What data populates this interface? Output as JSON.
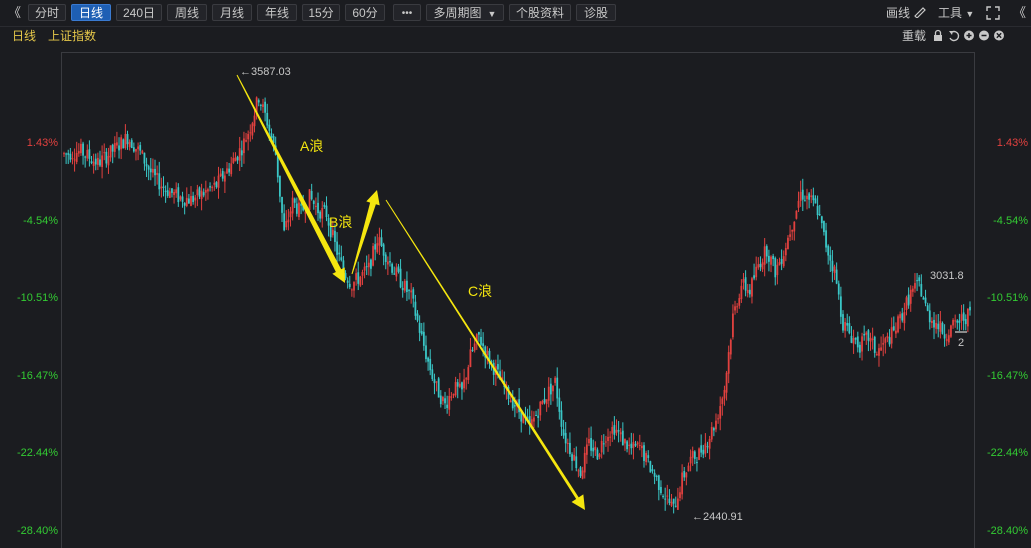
{
  "toolbar": {
    "collapse_left": "《",
    "tabs": [
      {
        "label": "分时",
        "active": false
      },
      {
        "label": "日线",
        "active": true
      },
      {
        "label": "240日",
        "active": false
      },
      {
        "label": "周线",
        "active": false
      },
      {
        "label": "月线",
        "active": false
      },
      {
        "label": "年线",
        "active": false
      },
      {
        "label": "15分",
        "active": false
      },
      {
        "label": "60分",
        "active": false
      }
    ],
    "more": "•••",
    "multi_period": "多周期图",
    "stock_info": "个股资料",
    "diagnose": "诊股",
    "draw": "画线",
    "tools": "工具",
    "expand_icon": "expand-icon",
    "collapse_right": "《"
  },
  "subbar": {
    "period": "日线",
    "index_name": "上证指数",
    "reload": "重载"
  },
  "y_axis": {
    "ticks": [
      "1.43%",
      "-4.54%",
      "-10.51%",
      "-16.47%",
      "-22.44%",
      "-28.40%"
    ],
    "tick_values": [
      1.43,
      -4.54,
      -10.51,
      -16.47,
      -22.44,
      -28.4
    ]
  },
  "annotations": {
    "high_label": "←3587.03",
    "low_label": "←2440.91",
    "last_label": "3031.8",
    "count_badge": "2",
    "wave_a": "A浪",
    "wave_b": "B浪",
    "wave_c": "C浪"
  },
  "colors": {
    "up": "#e2413f",
    "down": "#3ac7c7",
    "arrow": "#f5e60f",
    "active_tab": "#1e5fb4",
    "label_gold": "#e6c84a"
  },
  "chart_data": {
    "type": "candlestick",
    "title": "",
    "ylabel": "",
    "ylim": [
      -30.0,
      5.5
    ],
    "high": 3587.03,
    "low": 2440.91,
    "last": 3031.8,
    "trend_path_pct": [
      [
        0,
        0.5
      ],
      [
        8,
        0.7
      ],
      [
        16,
        -0.2
      ],
      [
        24,
        0.9
      ],
      [
        30,
        1.8
      ],
      [
        36,
        0.6
      ],
      [
        42,
        -1.2
      ],
      [
        48,
        -2.2
      ],
      [
        54,
        -2.8
      ],
      [
        60,
        -3.0
      ],
      [
        66,
        -2.5
      ],
      [
        72,
        -1.9
      ],
      [
        78,
        -0.5
      ],
      [
        84,
        1.0
      ],
      [
        88,
        2.6
      ],
      [
        92,
        4.9
      ],
      [
        96,
        3.0
      ],
      [
        100,
        0.5
      ],
      [
        104,
        -5.6
      ],
      [
        108,
        -3.2
      ],
      [
        112,
        -4.0
      ],
      [
        116,
        -2.8
      ],
      [
        120,
        -3.8
      ],
      [
        124,
        -4.1
      ],
      [
        128,
        -6.5
      ],
      [
        132,
        -8.5
      ],
      [
        136,
        -9.5
      ],
      [
        140,
        -8.9
      ],
      [
        144,
        -8.3
      ],
      [
        148,
        -6.0
      ],
      [
        152,
        -7.2
      ],
      [
        156,
        -8.5
      ],
      [
        160,
        -9.5
      ],
      [
        164,
        -10.5
      ],
      [
        168,
        -13.0
      ],
      [
        172,
        -15.5
      ],
      [
        176,
        -17.5
      ],
      [
        180,
        -18.8
      ],
      [
        184,
        -17.5
      ],
      [
        188,
        -17.8
      ],
      [
        192,
        -15.0
      ],
      [
        196,
        -13.5
      ],
      [
        200,
        -15.0
      ],
      [
        204,
        -16.2
      ],
      [
        208,
        -17.5
      ],
      [
        212,
        -18.5
      ],
      [
        216,
        -19.5
      ],
      [
        220,
        -20.5
      ],
      [
        224,
        -19.2
      ],
      [
        228,
        -18.0
      ],
      [
        232,
        -17.0
      ],
      [
        236,
        -21.0
      ],
      [
        240,
        -22.5
      ],
      [
        244,
        -24.0
      ],
      [
        248,
        -21.8
      ],
      [
        252,
        -22.5
      ],
      [
        256,
        -21.0
      ],
      [
        260,
        -20.5
      ],
      [
        264,
        -21.5
      ],
      [
        268,
        -22.2
      ],
      [
        272,
        -22.0
      ],
      [
        276,
        -23.3
      ],
      [
        280,
        -24.5
      ],
      [
        284,
        -25.8
      ],
      [
        288,
        -26.8
      ],
      [
        292,
        -24.5
      ],
      [
        296,
        -23.0
      ],
      [
        300,
        -22.5
      ],
      [
        304,
        -21.5
      ],
      [
        308,
        -20.0
      ],
      [
        312,
        -17.5
      ],
      [
        316,
        -12.0
      ],
      [
        320,
        -9.5
      ],
      [
        324,
        -10.0
      ],
      [
        328,
        -8.0
      ],
      [
        332,
        -6.8
      ],
      [
        336,
        -8.5
      ],
      [
        340,
        -7.0
      ],
      [
        344,
        -4.8
      ],
      [
        348,
        -2.5
      ],
      [
        352,
        -2.9
      ],
      [
        356,
        -3.8
      ],
      [
        360,
        -6.5
      ],
      [
        364,
        -8.5
      ],
      [
        368,
        -12.5
      ],
      [
        372,
        -13.5
      ],
      [
        376,
        -14.2
      ],
      [
        380,
        -13.6
      ],
      [
        384,
        -14.8
      ],
      [
        388,
        -14.0
      ],
      [
        392,
        -13.2
      ],
      [
        396,
        -11.8
      ],
      [
        400,
        -10.2
      ],
      [
        404,
        -9.5
      ],
      [
        408,
        -11.8
      ],
      [
        412,
        -12.5
      ],
      [
        416,
        -13.3
      ],
      [
        420,
        -12.8
      ],
      [
        424,
        -12.2
      ],
      [
        428,
        -11.8
      ]
    ]
  }
}
